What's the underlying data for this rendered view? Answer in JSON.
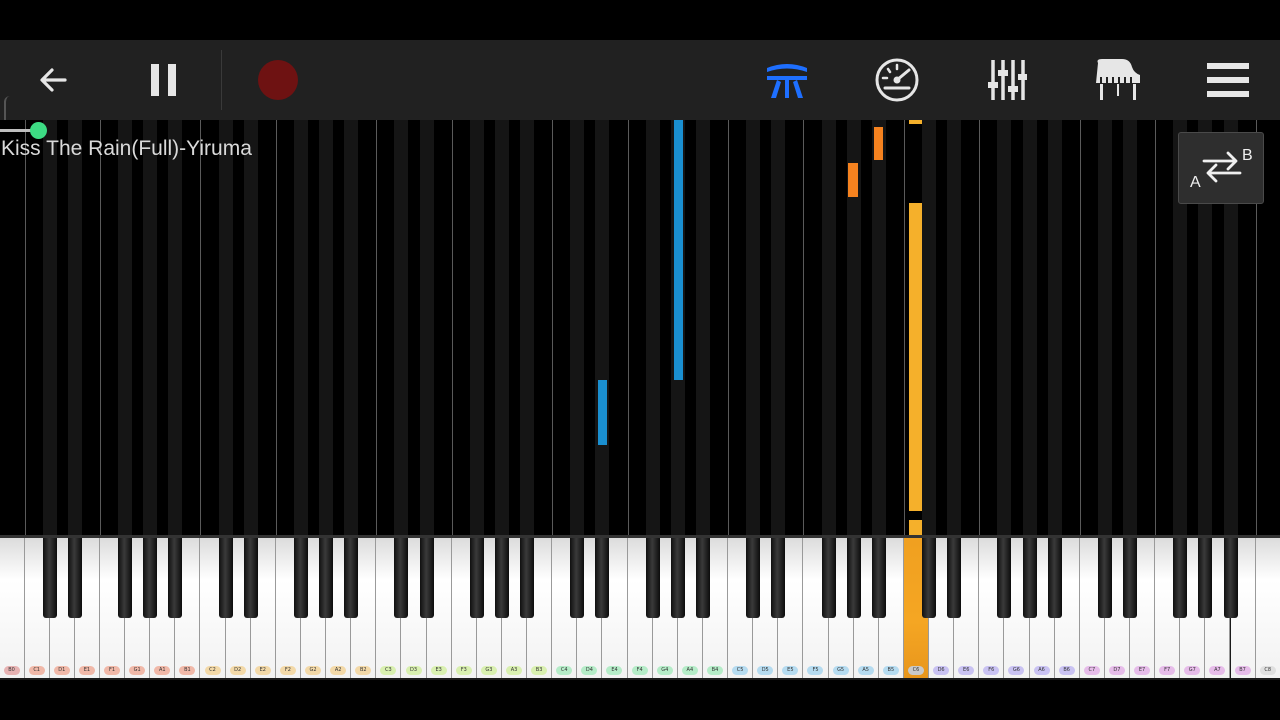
{
  "song": {
    "title": "Kiss The Rain(Full)-Yiruma",
    "progress": 0.03
  },
  "colors": {
    "left_hand": "#1a8fd0",
    "right_hand_orange": "#f5821f",
    "right_hand_yellow": "#f5b02b",
    "record": "#6e1212",
    "accent_blue": "#1e6fff",
    "progress_knob": "#3ddc84"
  },
  "toolbar": {
    "back_icon": "arrow-left-icon",
    "pause_icon": "pause-icon",
    "record_icon": "record-icon",
    "hands_icon": "two-hands-icon",
    "speed_icon": "speedometer-icon",
    "mixer_icon": "mixer-icon",
    "instrument_icon": "grand-piano-icon",
    "menu_icon": "hamburger-menu-icon"
  },
  "ab_loop": {
    "a": "A",
    "b": "B"
  },
  "keyboard": {
    "labels": [
      "B0",
      "C1",
      "D1",
      "E1",
      "F1",
      "G1",
      "A1",
      "B1",
      "C2",
      "D2",
      "E2",
      "F2",
      "G2",
      "A2",
      "B2",
      "C3",
      "D3",
      "E3",
      "F3",
      "G3",
      "A3",
      "B3",
      "C4",
      "D4",
      "E4",
      "F4",
      "G4",
      "A4",
      "B4",
      "C5",
      "D5",
      "E5",
      "F5",
      "G5",
      "A5",
      "B5",
      "C6",
      "D6",
      "E6",
      "F6",
      "G6",
      "A6",
      "B6",
      "C7",
      "D7",
      "E7",
      "F7",
      "G7",
      "A7",
      "B7",
      "C8"
    ],
    "active_key": "C6"
  }
}
